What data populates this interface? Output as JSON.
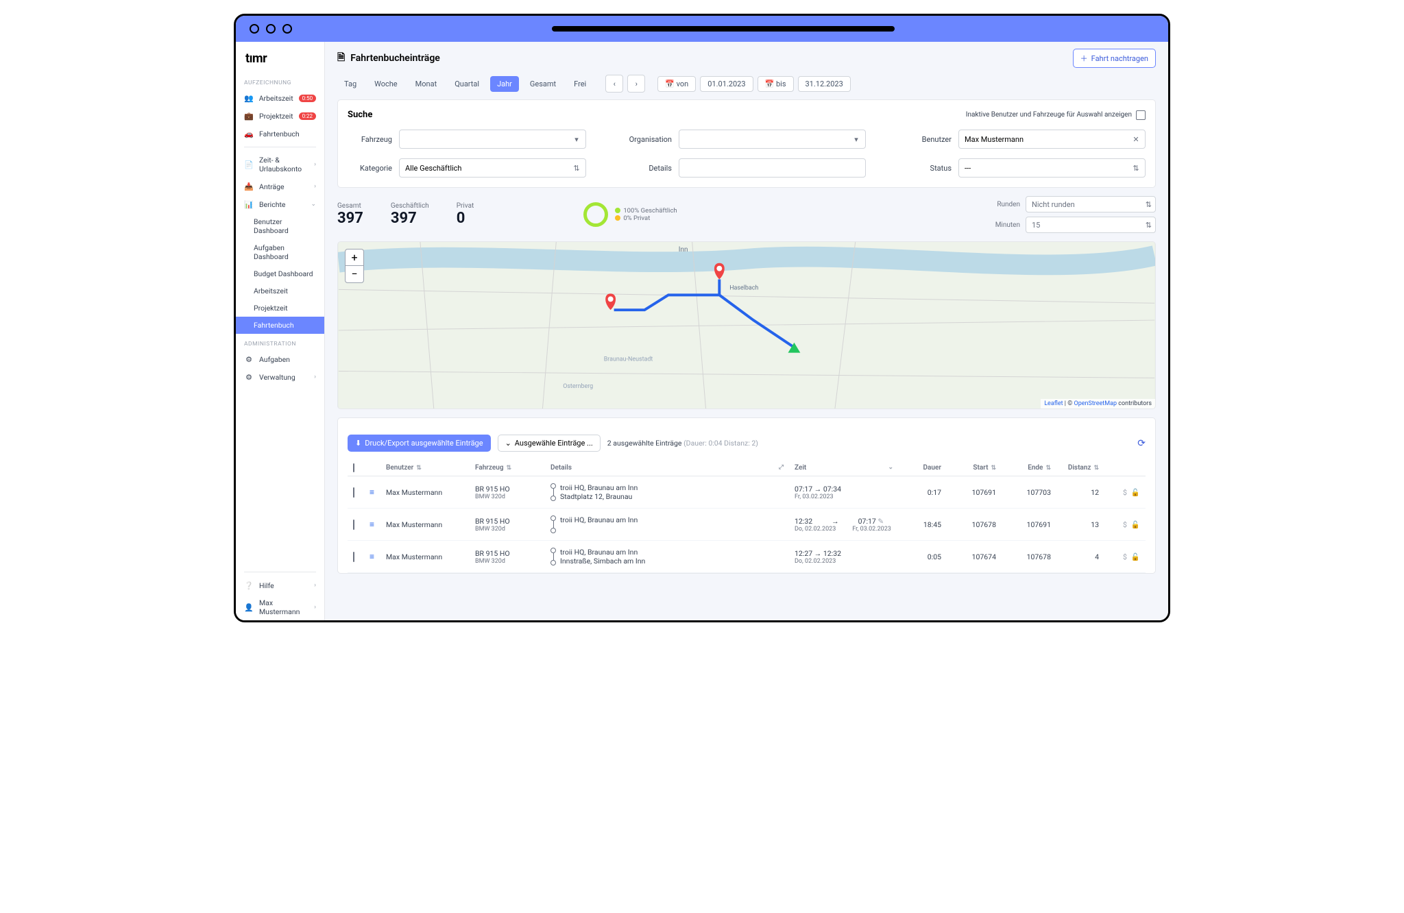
{
  "logo": "tımr",
  "page": {
    "title": "Fahrtenbucheinträge",
    "addTrip": "Fahrt nachtragen"
  },
  "sidebar": {
    "section1": "AUFZEICHNUNG",
    "items1": [
      {
        "label": "Arbeitszeit",
        "badge": "0:50"
      },
      {
        "label": "Projektzeit",
        "badge": "0:22"
      },
      {
        "label": "Fahrtenbuch"
      }
    ],
    "items2": [
      {
        "label": "Zeit- & Urlaubskonto",
        "chev": "›"
      },
      {
        "label": "Anträge",
        "chev": "›"
      },
      {
        "label": "Berichte",
        "chev": "⌄",
        "open": true
      }
    ],
    "reports": [
      "Benutzer Dashboard",
      "Aufgaben Dashboard",
      "Budget Dashboard",
      "Arbeitszeit",
      "Projektzeit",
      "Fahrtenbuch"
    ],
    "section3": "ADMINISTRATION",
    "items3": [
      {
        "label": "Aufgaben"
      },
      {
        "label": "Verwaltung",
        "chev": "›"
      }
    ],
    "footer": [
      {
        "label": "Hilfe",
        "chev": "›"
      },
      {
        "label": "Max Mustermann",
        "chev": "›"
      }
    ]
  },
  "period": {
    "tabs": [
      "Tag",
      "Woche",
      "Monat",
      "Quartal",
      "Jahr",
      "Gesamt",
      "Frei"
    ],
    "active": "Jahr",
    "fromLabel": "von",
    "from": "01.01.2023",
    "toLabel": "bis",
    "to": "31.12.2023"
  },
  "search": {
    "title": "Suche",
    "inactive": "Inaktive Benutzer und Fahrzeuge für Auswahl anzeigen",
    "fahrzeug": {
      "label": "Fahrzeug",
      "value": ""
    },
    "organisation": {
      "label": "Organisation",
      "value": ""
    },
    "benutzer": {
      "label": "Benutzer",
      "value": "Max Mustermann"
    },
    "kategorie": {
      "label": "Kategorie",
      "value": "Alle Geschäftlich"
    },
    "details": {
      "label": "Details",
      "value": ""
    },
    "status": {
      "label": "Status",
      "value": "---"
    }
  },
  "stats": {
    "gesamt": {
      "label": "Gesamt",
      "value": "397"
    },
    "geschaeftlich": {
      "label": "Geschäftlich",
      "value": "397"
    },
    "privat": {
      "label": "Privat",
      "value": "0"
    },
    "legend": {
      "g": "100% Geschäftlich",
      "p": "0% Privat"
    },
    "runden": {
      "label": "Runden",
      "value": "Nicht runden"
    },
    "minuten": {
      "label": "Minuten",
      "value": "15"
    }
  },
  "map": {
    "attrib": {
      "pre": "Leaflet",
      "mid": " | © ",
      "osm": "OpenStreetMap",
      "post": " contributors"
    }
  },
  "toolbar": {
    "export": "Druck/Export ausgewählte Einträge",
    "selected": "Ausgewähle Einträge ...",
    "count": "2 ausgewählte Einträge",
    "countDim": "(Dauer: 0:04 Distanz: 2)"
  },
  "table": {
    "cols": {
      "benutzer": "Benutzer",
      "fahrzeug": "Fahrzeug",
      "details": "Details",
      "zeit": "Zeit",
      "dauer": "Dauer",
      "start": "Start",
      "ende": "Ende",
      "distanz": "Distanz"
    },
    "rows": [
      {
        "benutzer": "Max Mustermann",
        "fahrzeug": "BR 915 HO",
        "fahrzeugSub": "BMW 320d",
        "detail1": "troii HQ, Braunau am Inn",
        "detail2": "Stadtplatz 12, Braunau",
        "zeit1": "07:17 → 07:34",
        "zeit2": "Fr, 03.02.2023",
        "dauer": "0:17",
        "start": "107691",
        "ende": "107703",
        "distanz": "12"
      },
      {
        "benutzer": "Max Mustermann",
        "fahrzeug": "BR 915 HO",
        "fahrzeugSub": "BMW 320d",
        "detail1": "troii HQ, Braunau am Inn",
        "detail2": "",
        "zeit1": "12:32",
        "zeitArrow": "→",
        "zeit1b": "07:17",
        "zeit2": "Do, 02.02.2023",
        "zeit2b": "Fr, 03.02.2023",
        "dauer": "18:45",
        "start": "107678",
        "ende": "107691",
        "distanz": "13",
        "edit": true
      },
      {
        "benutzer": "Max Mustermann",
        "fahrzeug": "BR 915 HO",
        "fahrzeugSub": "BMW 320d",
        "detail1": "troii HQ, Braunau am Inn",
        "detail2": "Innstraße, Simbach am Inn",
        "zeit1": "12:27 → 12:32",
        "zeit2": "Do, 02.02.2023",
        "dauer": "0:05",
        "start": "107674",
        "ende": "107678",
        "distanz": "4"
      }
    ]
  }
}
